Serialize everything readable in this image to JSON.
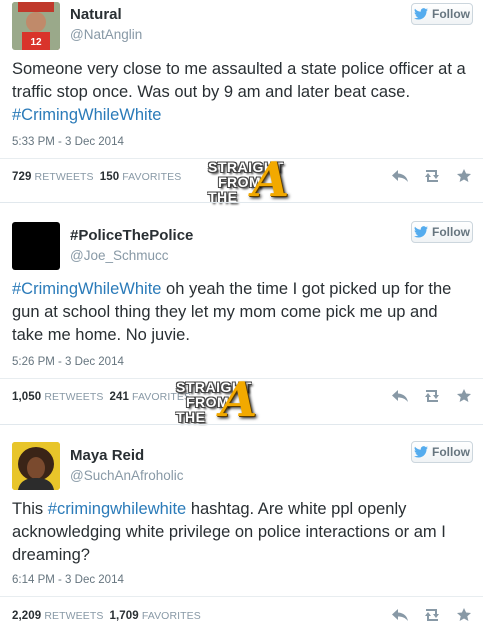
{
  "follow_label": "Follow",
  "retweets_label": "RETWEETS",
  "favorites_label": "FAVORITES",
  "watermark": {
    "line1": "STRAIGHT",
    "line2": "FROM",
    "line3": "THE",
    "letter": "A"
  },
  "tweets": [
    {
      "name": "Natural",
      "handle": "@NatAnglin",
      "text_plain": "Someone very close to me assaulted a state police officer at a traffic stop once. Was out by 9 am and later beat case. ",
      "hashtag": "#CrimingWhileWhite",
      "time": "5:33 PM - 3 Dec 2014",
      "retweets": "729",
      "favorites": "150"
    },
    {
      "name": "#PoliceThePolice",
      "handle": "@Joe_Schmucc",
      "hashtag": "#CrimingWhileWhite",
      "text_plain": " oh yeah the time I got picked up for the gun at school thing they let my mom come pick me up and take me home.  No juvie.",
      "time": "5:26 PM - 3 Dec 2014",
      "retweets": "1,050",
      "favorites": "241"
    },
    {
      "name": "Maya Reid",
      "handle": "@SuchAnAfroholic",
      "text_before": "This ",
      "hashtag": "#crimingwhilewhite",
      "text_after": " hashtag. Are white ppl openly acknowledging white privilege on police interactions or am I dreaming?",
      "time": "6:14 PM - 3 Dec 2014",
      "retweets": "2,209",
      "favorites": "1,709"
    }
  ],
  "colors": {
    "hashtag": "#2b7bb9",
    "watermark_gold": "#f2a900",
    "bird_blue": "#55acee"
  }
}
